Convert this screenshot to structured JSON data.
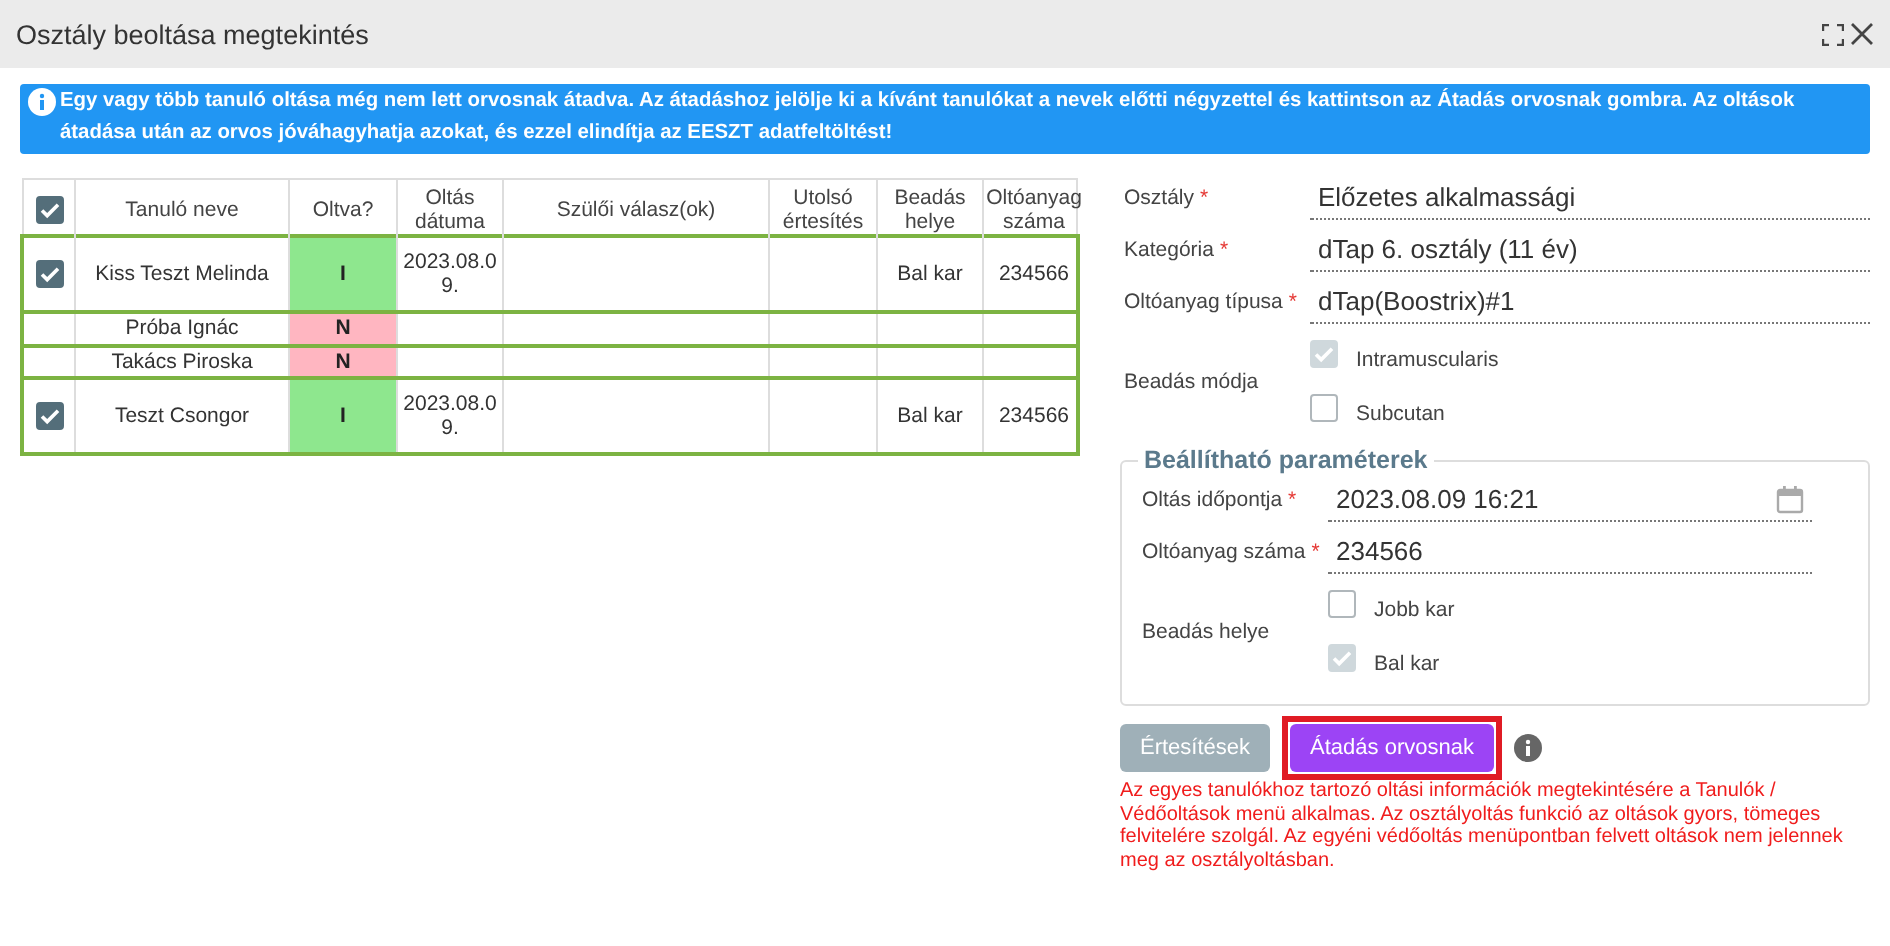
{
  "window": {
    "title": "Osztály beoltása megtekintés"
  },
  "notice": "Egy vagy több tanuló oltása még nem lett orvosnak átadva. Az átadáshoz jelölje ki a kívánt tanulókat a nevek előtti négyzettel és kattintson az Átadás orvosnak gombra. Az oltások átadása után az orvos jóváhagyhatja azokat, és ezzel elindítja az EESZT adatfeltöltést!",
  "table": {
    "all_checked": true,
    "columns": [
      "Tanuló neve",
      "Oltva?",
      "Oltás dátuma",
      "Szülői válasz(ok)",
      "Utolsó értesítés",
      "Beadás helye",
      "Oltóanyag száma"
    ],
    "rows": [
      {
        "checked": true,
        "name": "Kiss Teszt Melinda",
        "vaccinated": true,
        "status": "I",
        "date": "2023.08.09.",
        "site": "Bal kar",
        "batch": "234566"
      },
      {
        "checked": false,
        "name": "Próba Ignác",
        "vaccinated": false,
        "status": "N"
      },
      {
        "checked": false,
        "name": "Takács Piroska",
        "vaccinated": false,
        "status": "N"
      },
      {
        "checked": true,
        "name": "Teszt Csongor",
        "vaccinated": true,
        "status": "I",
        "date": "2023.08.09.",
        "site": "Bal kar",
        "batch": "234566"
      }
    ]
  },
  "form": {
    "fields": [
      {
        "label": "Osztály",
        "required_mark": "*",
        "value": "Előzetes alkalmassági"
      },
      {
        "label": "Kategória",
        "required_mark": "*",
        "value": "dTap 6. osztály (11 év)"
      },
      {
        "label": "Oltóanyag típusa",
        "required_mark": "*",
        "value": "dTap(Boostrix)#1"
      }
    ],
    "method": {
      "label": "Beadás módja",
      "options": [
        {
          "label": "Intramuscularis",
          "checked": true
        },
        {
          "label": "Subcutan",
          "checked": false
        }
      ]
    }
  },
  "parameters": {
    "title": "Beállítható paraméterek",
    "fields": [
      {
        "kind": "date",
        "label": "Oltás időpontja",
        "required_mark": "*",
        "value": "2023.08.09 16:21"
      },
      {
        "kind": "text",
        "label": "Oltóanyag száma",
        "required_mark": "*",
        "value": "234566"
      }
    ],
    "site": {
      "label": "Beadás helye",
      "options": [
        {
          "label": "Jobb kar",
          "checked": false
        },
        {
          "label": "Bal kar",
          "checked": true
        }
      ]
    }
  },
  "buttons": [
    {
      "label": "Értesítések",
      "disabled": true,
      "highlighted": false
    },
    {
      "label": "Átadás orvosnak",
      "disabled": false,
      "highlighted": true
    }
  ],
  "note": "Az egyes tanulókhoz tartozó oltási információk megtekintésére a Tanulók / Védőoltások menü alkalmas. Az osztályoltás funkció az oltások gyors, tömeges felvitelére szolgál. Az egyéni védőoltás menüpontban felvett oltások nem jelennek meg az osztályoltásban."
}
